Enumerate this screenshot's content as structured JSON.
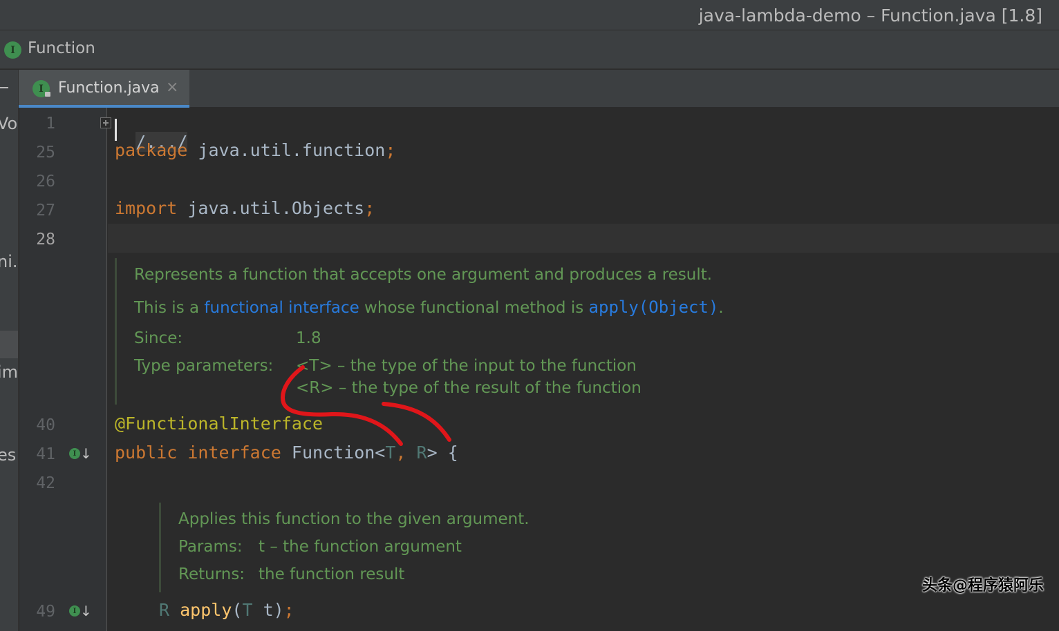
{
  "window": {
    "title": "java-lambda-demo – Function.java [1.8]"
  },
  "breadcrumb": {
    "icon_letter": "I",
    "label": "Function"
  },
  "left_panel": {
    "fragments": [
      "Vo",
      "ni.v",
      "im",
      "es"
    ]
  },
  "tab": {
    "icon_letter": "I",
    "name": "Function.java",
    "close_glyph": "×"
  },
  "editor": {
    "line_numbers": [
      "1",
      "25",
      "26",
      "27",
      "28",
      "40",
      "41",
      "42",
      "49"
    ],
    "current_line": "28",
    "lines": {
      "l1_folded": "/.../",
      "l25_kw": "package",
      "l25_rest": " java.util.function",
      "l25_semi": ";",
      "l27_kw": "import",
      "l27_rest": " java.util.Objects",
      "l27_semi": ";",
      "l40_ann": "@FunctionalInterface",
      "l41_kw1": "public",
      "l41_kw2": "interface",
      "l41_name": " Function<",
      "l41_t": "T",
      "l41_comma": ",",
      "l41_r": "R",
      "l41_end": "> {",
      "l49_r": "R",
      "l49_fn": "apply",
      "l49_open": "(",
      "l49_t": "T",
      "l49_param": " t)",
      "l49_semi": ";"
    },
    "doc_interface": {
      "line1": "Represents a function that accepts one argument and produces a result.",
      "line2_pre": "This is a ",
      "line2_link": "functional interface",
      "line2_mid": " whose functional method is ",
      "line2_method": "apply(Object)",
      "line2_end": ".",
      "since_label": "Since:",
      "since_value": "1.8",
      "type_params_label": "Type parameters:",
      "type_param_t": "<T> – the type of the input to the function",
      "type_param_r": "<R> – the type of the result of the function"
    },
    "doc_apply": {
      "line1": "Applies this function to the given argument.",
      "params_label": "Params:",
      "params_value": "t – the function argument",
      "returns_label": "Returns:",
      "returns_value": "the function result"
    }
  },
  "annotation": {
    "stroke_color": "#e0161a"
  },
  "watermark": {
    "text": "头条@程序猿阿乐"
  },
  "colors": {
    "keyword": "#cc7832",
    "annotation": "#bbb529",
    "type_param": "#507874",
    "method": "#ffc66d",
    "doc_text": "#629755",
    "doc_link": "#287bde"
  }
}
